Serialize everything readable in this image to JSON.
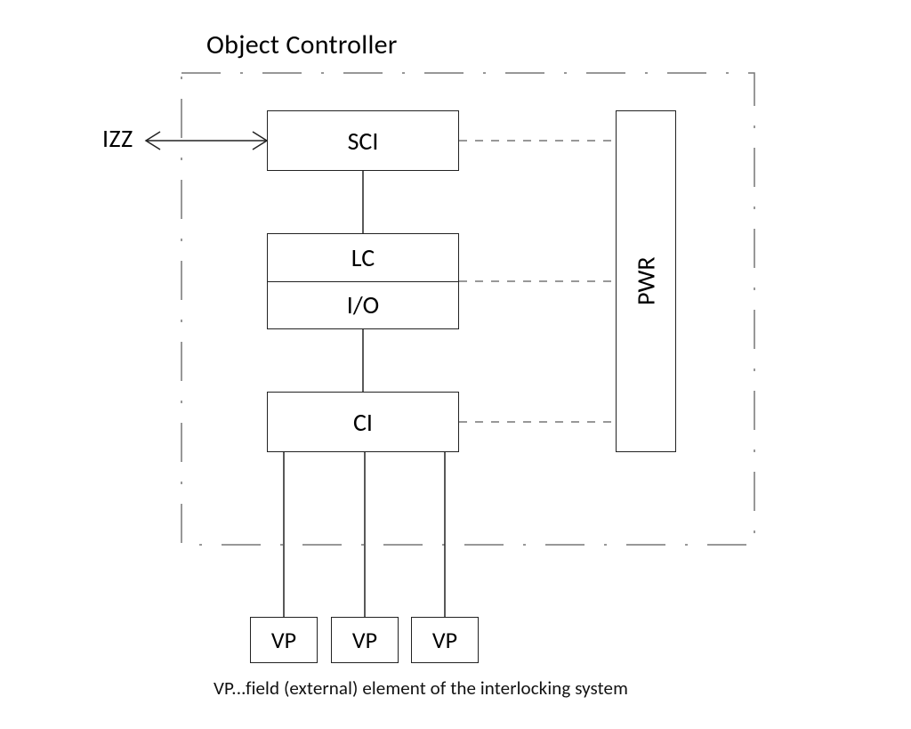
{
  "title": "Object Controller",
  "external_label": "IZZ",
  "blocks": {
    "sci": "SCI",
    "lc": "LC",
    "io": "I/O",
    "ci": "CI",
    "pwr": "PWR"
  },
  "vp_items": [
    "VP",
    "VP",
    "VP"
  ],
  "footnote": "VP...field (external) element of the interlocking system"
}
